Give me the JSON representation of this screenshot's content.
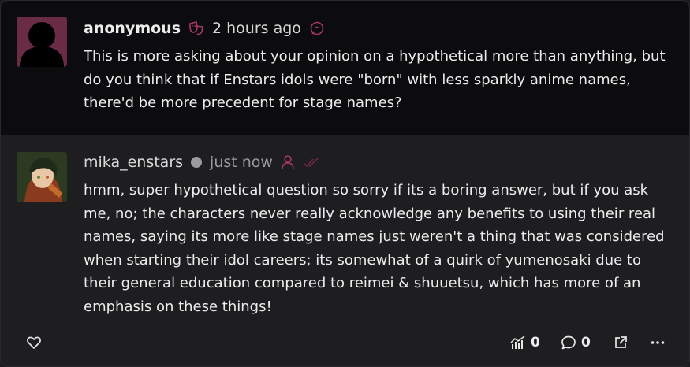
{
  "question": {
    "username": "anonymous",
    "time": "2 hours ago",
    "text": "This is more asking about your opinion on a hypothetical more than anything, but do you think that if Enstars idols were \"born\" with less sparkly anime names, there'd be more precedent for stage names?",
    "icons": [
      "theater-masks-icon",
      "chat-bubble-icon"
    ]
  },
  "answer": {
    "username": "mika_enstars",
    "time": "just now",
    "text": "hmm, super hypothetical question so sorry if its a boring answer, but if you ask me, no; the characters never really acknowledge any benefits to using their real names, saying its more like stage names just weren't a thing that was considered when starting their idol careers; its somewhat of a quirk of yumenosaki due to their general education compared to reimei & shuuetsu, which has more of an emphasis on these things!",
    "icons": [
      "status-dot-icon",
      "person-icon",
      "double-check-icon"
    ]
  },
  "footer": {
    "views": "0",
    "comments": "0"
  },
  "colors": {
    "accent_pink": "#a8385e",
    "background": "#1e1e21",
    "question_background": "#0c0c0e"
  }
}
